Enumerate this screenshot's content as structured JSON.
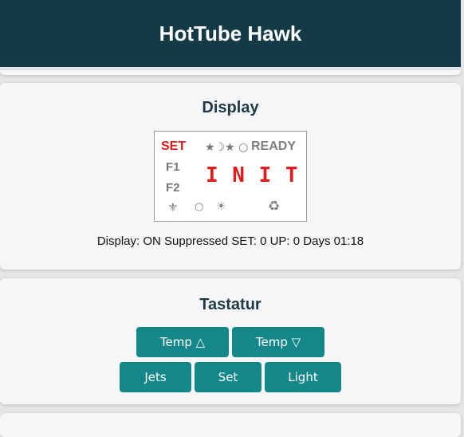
{
  "header": {
    "title": "HotTube Hawk"
  },
  "display_section": {
    "title": "Display",
    "lcd": {
      "set": "SET",
      "f1": "F1",
      "f2": "F2",
      "moon_icons": "★☽★ ○",
      "ready": "READY",
      "main_text": "I N I T",
      "fleur_icon": "⚜",
      "circle_icon": "○",
      "sun_icon": "☀",
      "recycle_icon": "♻"
    },
    "status_text": "Display: ON Suppressed SET: 0 UP: 0 Days 01:18"
  },
  "keyboard_section": {
    "title": "Tastatur",
    "buttons": {
      "temp_up": "Temp △",
      "temp_down": "Temp ▽",
      "jets": "Jets",
      "set": "Set",
      "light": "Light"
    }
  },
  "colors": {
    "header_bg": "#143a47",
    "button_bg": "#14878a",
    "lcd_active_red": "#e01b1b",
    "lcd_inactive_gray": "#808080"
  }
}
